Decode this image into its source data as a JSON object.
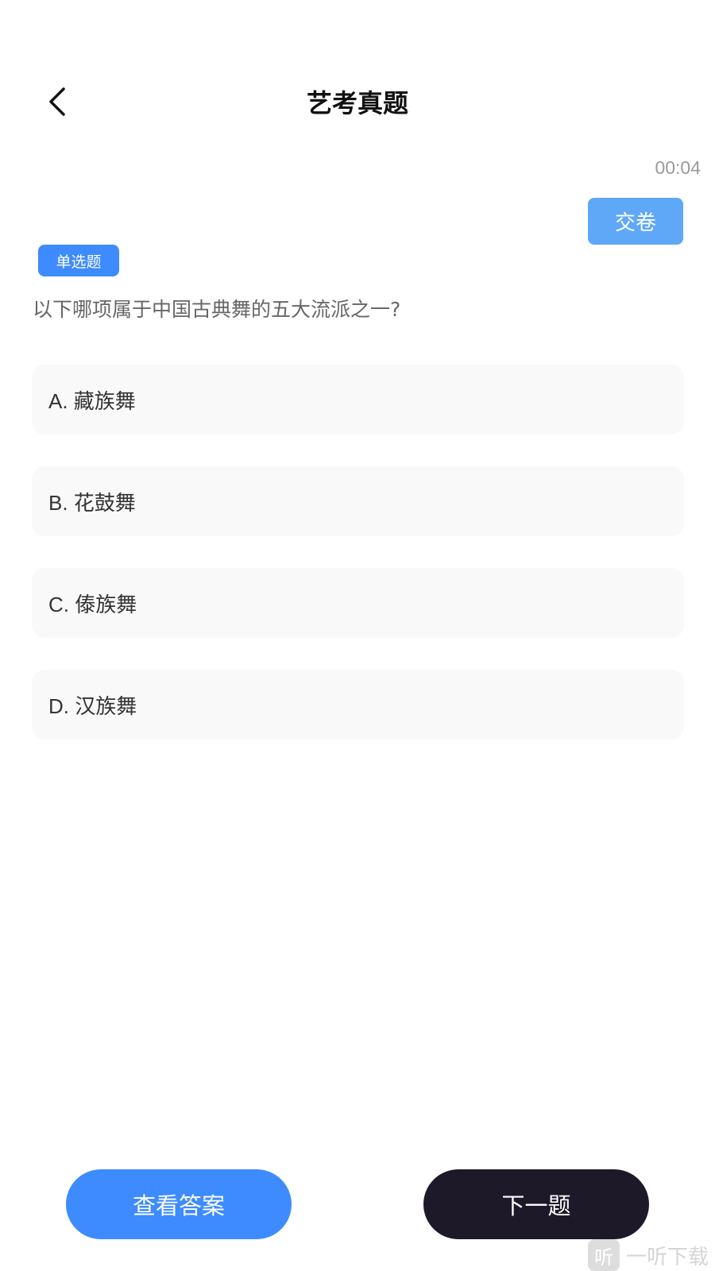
{
  "header": {
    "title": "艺考真题"
  },
  "timer": "00:04",
  "submit_label": "交卷",
  "question": {
    "type_tag": "单选题",
    "text": "以下哪项属于中国古典舞的五大流派之一?"
  },
  "options": [
    {
      "label": "A. 藏族舞"
    },
    {
      "label": "B. 花鼓舞"
    },
    {
      "label": "C. 傣族舞"
    },
    {
      "label": "D. 汉族舞"
    }
  ],
  "footer": {
    "view_answer_label": "查看答案",
    "next_label": "下一题"
  },
  "watermark": {
    "logo_char": "听",
    "text": "一听下载"
  },
  "colors": {
    "primary_blue": "#3d8bff",
    "submit_blue": "#5ea8f7",
    "dark_button": "#1e1928",
    "option_bg": "#f9f9f9"
  }
}
